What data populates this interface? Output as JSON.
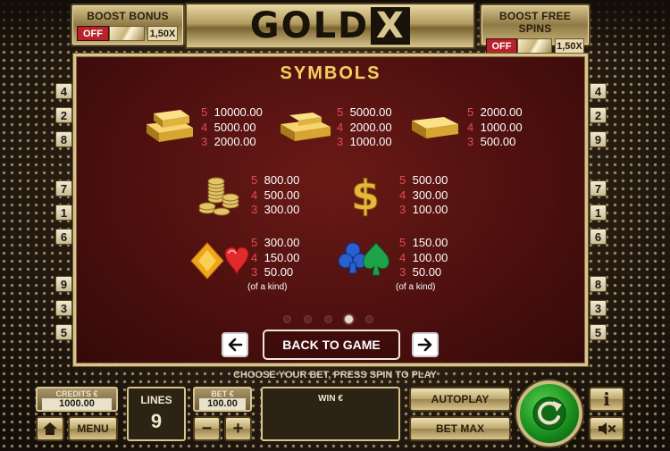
{
  "header": {
    "boost_bonus": {
      "title": "BOOST BONUS",
      "state": "OFF",
      "multiplier": "1,50X"
    },
    "boost_free_spins": {
      "title": "BOOST FREE SPINS",
      "state": "OFF",
      "multiplier": "1,50X"
    },
    "logo": {
      "main": "GOLD",
      "x": "X"
    }
  },
  "lines": {
    "left": [
      "4",
      "2",
      "8",
      "7",
      "1",
      "6",
      "9",
      "3",
      "5"
    ],
    "right": [
      "4",
      "2",
      "9",
      "7",
      "1",
      "6",
      "8",
      "3",
      "5"
    ]
  },
  "paytable": {
    "title": "SYMBOLS",
    "rows": [
      {
        "symbol": "gold-bar-large-icon",
        "payouts": [
          {
            "k": "5",
            "v": "10000.00"
          },
          {
            "k": "4",
            "v": "5000.00"
          },
          {
            "k": "3",
            "v": "2000.00"
          }
        ]
      },
      {
        "symbol": "gold-bar-double-icon",
        "payouts": [
          {
            "k": "5",
            "v": "5000.00"
          },
          {
            "k": "4",
            "v": "2000.00"
          },
          {
            "k": "3",
            "v": "1000.00"
          }
        ]
      },
      {
        "symbol": "gold-bar-single-icon",
        "payouts": [
          {
            "k": "5",
            "v": "2000.00"
          },
          {
            "k": "4",
            "v": "1000.00"
          },
          {
            "k": "3",
            "v": "500.00"
          }
        ]
      },
      {
        "symbol": "gold-coins-icon",
        "payouts": [
          {
            "k": "5",
            "v": "800.00"
          },
          {
            "k": "4",
            "v": "500.00"
          },
          {
            "k": "3",
            "v": "300.00"
          }
        ]
      },
      {
        "symbol": "dollar-sign-icon",
        "payouts": [
          {
            "k": "5",
            "v": "500.00"
          },
          {
            "k": "4",
            "v": "300.00"
          },
          {
            "k": "3",
            "v": "100.00"
          }
        ]
      },
      {
        "symbol": "diamond-heart-gems-icon",
        "payouts": [
          {
            "k": "5",
            "v": "300.00"
          },
          {
            "k": "4",
            "v": "150.00"
          },
          {
            "k": "3",
            "v": "50.00"
          }
        ],
        "note": "(of a kind)"
      },
      {
        "symbol": "club-spade-gems-icon",
        "payouts": [
          {
            "k": "5",
            "v": "150.00"
          },
          {
            "k": "4",
            "v": "100.00"
          },
          {
            "k": "3",
            "v": "50.00"
          }
        ],
        "note": "(of a kind)"
      }
    ],
    "page_index": 4,
    "page_count": 5,
    "back_label": "BACK TO GAME"
  },
  "instruction": "CHOOSE YOUR BET, PRESS SPIN TO PLAY",
  "controls": {
    "credits_label": "CREDITS €",
    "credits_value": "1000.00",
    "menu_label": "MENU",
    "lines_label": "LINES",
    "lines_value": "9",
    "bet_label": "BET €",
    "bet_value": "100.00",
    "minus": "−",
    "plus": "+",
    "win_label": "WIN €",
    "autoplay_label": "AUTOPLAY",
    "betmax_label": "BET MAX",
    "info_label": "i"
  },
  "colors": {
    "panel_bg": "#4b0f0e",
    "gold_accent": "#d8c48d",
    "title_gold": "#f3cf63",
    "payout_key_red": "#e24c55",
    "spin_green": "#17891c"
  }
}
